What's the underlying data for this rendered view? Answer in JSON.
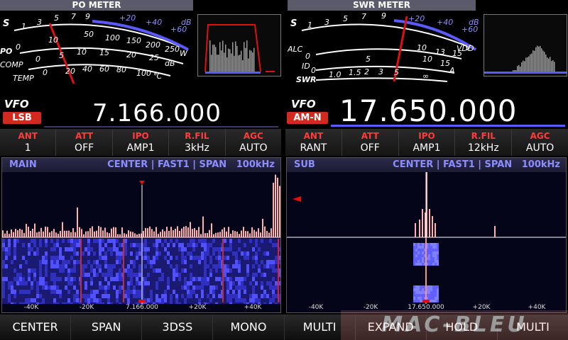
{
  "meters": {
    "left_title": "PO METER",
    "right_title": "SWR METER",
    "left_scales": {
      "s": [
        "S",
        "1",
        "3",
        "5",
        "7",
        "9",
        "+20",
        "+40",
        "+60",
        "dB"
      ],
      "po": [
        "PO",
        "0",
        "10",
        "50",
        "100",
        "150",
        "200",
        "250",
        "W"
      ],
      "comp": [
        "COMP",
        "0",
        "5",
        "10",
        "15",
        "20",
        "25",
        "dB"
      ],
      "temp": [
        "TEMP",
        "0",
        "20",
        "40",
        "60",
        "80",
        "100",
        "℃"
      ]
    },
    "right_scales": {
      "s": [
        "S",
        "1",
        "3",
        "5",
        "7",
        "9",
        "+20",
        "+40",
        "+60",
        "dB"
      ],
      "alc": [
        "ALC",
        "0",
        "10",
        "13",
        "15",
        "V",
        "VDD"
      ],
      "id": [
        "ID",
        "0",
        "5",
        "10",
        "15",
        "A"
      ],
      "swr": [
        "SWR",
        "1.0",
        "1.5",
        "2",
        "3",
        "5",
        "∞"
      ]
    }
  },
  "main": {
    "vfo_label": "VFO",
    "mode": "LSB",
    "frequency": "7.166.000",
    "params": [
      {
        "title": "ANT",
        "value": "1"
      },
      {
        "title": "ATT",
        "value": "OFF"
      },
      {
        "title": "IPO",
        "value": "AMP1"
      },
      {
        "title": "R.FIL",
        "value": "3kHz"
      },
      {
        "title": "AGC",
        "value": "AUTO"
      }
    ],
    "scope": {
      "name": "MAIN",
      "settings": "CENTER | FAST1 | SPAN",
      "span": "100kHz",
      "axis": [
        "-40K",
        "-20K",
        "7.166.000",
        "+20K",
        "+40K"
      ]
    }
  },
  "sub": {
    "vfo_label": "VFO",
    "mode": "AM-N",
    "frequency": "17.650.000",
    "params": [
      {
        "title": "ANT",
        "value": "RANT"
      },
      {
        "title": "ATT",
        "value": "OFF"
      },
      {
        "title": "IPO",
        "value": "AMP1"
      },
      {
        "title": "R.FIL",
        "value": "12kHz"
      },
      {
        "title": "AGC",
        "value": "AUTO"
      }
    ],
    "scope": {
      "name": "SUB",
      "settings": "CENTER | FAST1 | SPAN",
      "span": "100kHz",
      "axis": [
        "-40K",
        "-20K",
        "17.650.000",
        "+20K",
        "+40K"
      ]
    }
  },
  "function_keys": [
    "CENTER",
    "SPAN",
    "3DSS",
    "MONO",
    "MULTI",
    "EXPAND",
    "HOLD",
    "MULTI"
  ],
  "watermark": "MAC-BLEU",
  "colors": {
    "accent": "#d22a1e",
    "scope_blue": "#3a3aff",
    "spectrum_pink": "#ffb0b0",
    "needle": "#e01010",
    "bar_blue": "#5a5aff"
  }
}
